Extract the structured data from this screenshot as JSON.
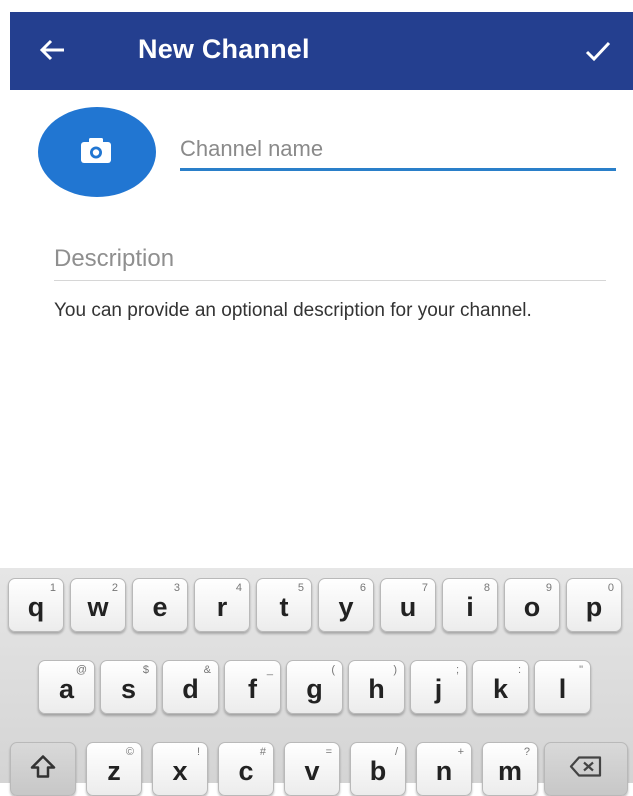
{
  "appbar": {
    "title": "New Channel",
    "back_icon": "arrow-left-icon",
    "confirm_icon": "checkmark-icon",
    "background": "#243f8f"
  },
  "form": {
    "channel_name_placeholder": "Channel name",
    "channel_name_value": "",
    "description_placeholder": "Description",
    "description_value": "",
    "hint": "You can provide an optional description for your channel.",
    "accent": "#2176d2"
  },
  "keyboard": {
    "row1": [
      {
        "label": "q",
        "sub": "1"
      },
      {
        "label": "w",
        "sub": "2"
      },
      {
        "label": "e",
        "sub": "3"
      },
      {
        "label": "r",
        "sub": "4"
      },
      {
        "label": "t",
        "sub": "5"
      },
      {
        "label": "y",
        "sub": "6"
      },
      {
        "label": "u",
        "sub": "7"
      },
      {
        "label": "i",
        "sub": "8"
      },
      {
        "label": "o",
        "sub": "9"
      },
      {
        "label": "p",
        "sub": "0"
      }
    ],
    "row2": [
      {
        "label": "a",
        "sub": "@"
      },
      {
        "label": "s",
        "sub": "$"
      },
      {
        "label": "d",
        "sub": "&"
      },
      {
        "label": "f",
        "sub": "_"
      },
      {
        "label": "g",
        "sub": "("
      },
      {
        "label": "h",
        "sub": ")"
      },
      {
        "label": "j",
        "sub": ";"
      },
      {
        "label": "k",
        "sub": ":"
      },
      {
        "label": "l",
        "sub": "\""
      }
    ],
    "row3": [
      {
        "label": "z",
        "sub": "©"
      },
      {
        "label": "x",
        "sub": "!"
      },
      {
        "label": "c",
        "sub": "#"
      },
      {
        "label": "v",
        "sub": "="
      },
      {
        "label": "b",
        "sub": "/"
      },
      {
        "label": "n",
        "sub": "+"
      },
      {
        "label": "m",
        "sub": "?"
      }
    ],
    "shift_icon": "shift-arrow-icon",
    "backspace_icon": "backspace-icon"
  }
}
